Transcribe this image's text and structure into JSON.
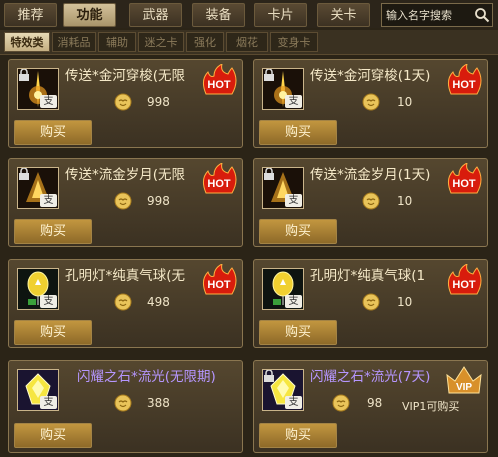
{
  "top_tabs": [
    {
      "label": "推荐",
      "active": false
    },
    {
      "label": "功能",
      "active": true
    },
    {
      "label": "武器",
      "active": false
    },
    {
      "label": "装备",
      "active": false
    },
    {
      "label": "卡片",
      "active": false
    },
    {
      "label": "关卡",
      "active": false
    }
  ],
  "search": {
    "placeholder": "输入名字搜索"
  },
  "sub_tabs": [
    {
      "label": "特效类",
      "active": true
    },
    {
      "label": "消耗品",
      "active": false
    },
    {
      "label": "辅助",
      "active": false
    },
    {
      "label": "迷之卡",
      "active": false
    },
    {
      "label": "强化",
      "active": false
    },
    {
      "label": "烟花",
      "active": false
    },
    {
      "label": "变身卡",
      "active": false
    }
  ],
  "items": [
    {
      "name": "传送*金河穿梭(无限",
      "price": "998",
      "badge": "HOT",
      "buy": "购买"
    },
    {
      "name": "传送*金河穿梭(1天)",
      "price": "10",
      "badge": "HOT",
      "buy": "购买"
    },
    {
      "name": "传送*流金岁月(无限",
      "price": "998",
      "badge": "HOT",
      "buy": "购买"
    },
    {
      "name": "传送*流金岁月(1天)",
      "price": "10",
      "badge": "HOT",
      "buy": "购买"
    },
    {
      "name": "孔明灯*纯真气球(无",
      "price": "498",
      "badge": "HOT",
      "buy": "购买"
    },
    {
      "name": "孔明灯*纯真气球(1",
      "price": "10",
      "badge": "HOT",
      "buy": "购买"
    },
    {
      "name": "闪耀之石*流光(无限期)",
      "price": "388",
      "badge": "",
      "buy": "购买"
    },
    {
      "name": "闪耀之石*流光(7天)",
      "price": "98",
      "badge": "VIP",
      "note": "VIP1可购买",
      "buy": "购买"
    }
  ],
  "pay_tag": "支",
  "colors": {
    "accent": "#c2963f",
    "hot": "#e02010",
    "vip": "#d8902a",
    "purple_name": "#b696ff"
  }
}
